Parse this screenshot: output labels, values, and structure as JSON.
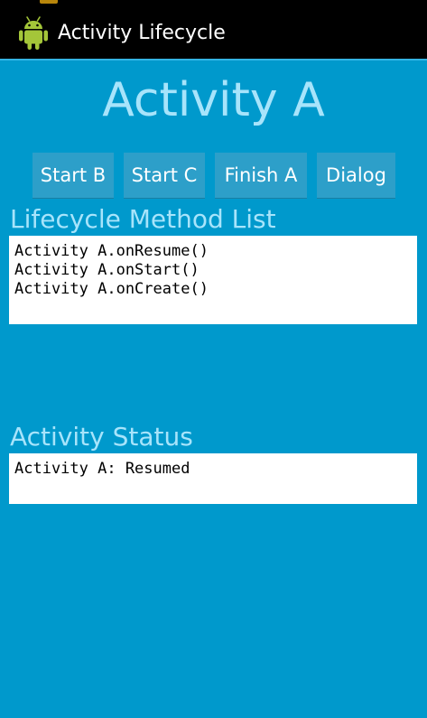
{
  "app": {
    "title": "Activity Lifecycle",
    "icon": "android-robot-icon",
    "icon_color": "#a4c639"
  },
  "header": {
    "title": "Activity A"
  },
  "buttons": {
    "start_b": "Start B",
    "start_c": "Start C",
    "finish_a": "Finish A",
    "dialog": "Dialog"
  },
  "lifecycle": {
    "label": "Lifecycle Method List",
    "lines": [
      "Activity A.onResume()",
      "Activity A.onStart()",
      "Activity A.onCreate()"
    ]
  },
  "status": {
    "label": "Activity Status",
    "text": "Activity A: Resumed"
  },
  "colors": {
    "background": "#0099cc",
    "accent_text": "#a7e4fb",
    "button": "#2d9fc9",
    "action_bar": "#000000"
  }
}
